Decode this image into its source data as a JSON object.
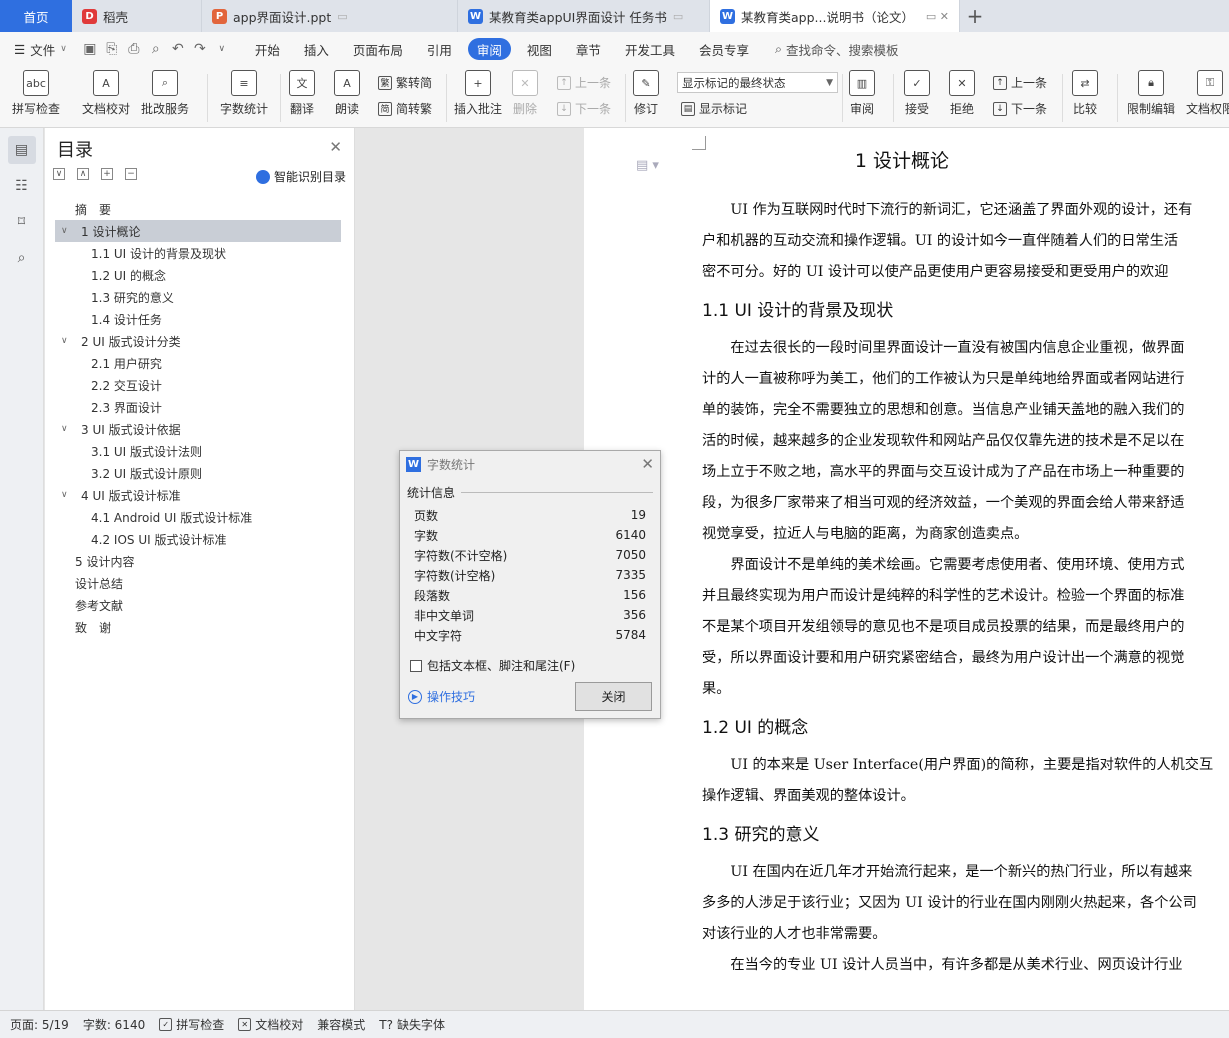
{
  "tabs": [
    {
      "label": "首页"
    },
    {
      "label": "稻壳",
      "icon": "docer-icon",
      "color": "#e03a3a"
    },
    {
      "label": "app界面设计.ppt",
      "icon": "ppt-icon",
      "color": "#e2653c"
    },
    {
      "label": "某教育类appUI界面设计 任务书",
      "icon": "word-icon",
      "color": "#2f6fe0"
    },
    {
      "label": "某教育类app...说明书（论文）",
      "icon": "word-icon",
      "color": "#2f6fe0"
    }
  ],
  "menubar": {
    "file": "文件",
    "items": [
      "开始",
      "插入",
      "页面布局",
      "引用",
      "审阅",
      "视图",
      "章节",
      "开发工具",
      "会员专享"
    ],
    "active": "审阅",
    "search": "查找命令、搜索模板"
  },
  "ribbon": {
    "spell": "拼写检查",
    "proof": "文档校对",
    "batch": "批改服务",
    "wordcount": "字数统计",
    "translate": "翻译",
    "read": "朗读",
    "t2s": "繁转简",
    "s2t": "简转繁",
    "insert_comment": "插入批注",
    "delete": "删除",
    "prev_c": "上一条",
    "next_c": "下一条",
    "revise": "修订",
    "display_mode": "显示标记的最终状态",
    "show_marks": "显示标记",
    "review": "审阅",
    "accept": "接受",
    "reject": "拒绝",
    "prev": "上一条",
    "next": "下一条",
    "compare": "比较",
    "restrict": "限制编辑",
    "doc_perm": "文档权限"
  },
  "toc": {
    "title": "目录",
    "smart": "智能识别目录",
    "items": [
      {
        "label": "摘　要",
        "level": 1,
        "caret": ""
      },
      {
        "label": "1  设计概论",
        "level": 1,
        "caret": "∨",
        "selected": true
      },
      {
        "label": "1.1 UI 设计的背景及现状",
        "level": 2
      },
      {
        "label": "1.2 UI 的概念",
        "level": 2
      },
      {
        "label": "1.3 研究的意义",
        "level": 2
      },
      {
        "label": "1.4 设计任务",
        "level": 2
      },
      {
        "label": "2 UI 版式设计分类",
        "level": 1,
        "caret": "∨"
      },
      {
        "label": "2.1 用户研究",
        "level": 2
      },
      {
        "label": "2.2  交互设计",
        "level": 2
      },
      {
        "label": "2.3  界面设计",
        "level": 2
      },
      {
        "label": "3 UI 版式设计依据",
        "level": 1,
        "caret": "∨"
      },
      {
        "label": "3.1 UI 版式设计法则",
        "level": 2
      },
      {
        "label": "3.2 UI 版式设计原则",
        "level": 2
      },
      {
        "label": "4 UI 版式设计标准",
        "level": 1,
        "caret": "∨"
      },
      {
        "label": "4.1 Android UI 版式设计标准",
        "level": 2
      },
      {
        "label": "4.2 IOS UI 版式设计标准",
        "level": 2
      },
      {
        "label": "5  设计内容",
        "level": 1,
        "caret": ""
      },
      {
        "label": "设计总结",
        "level": 1,
        "caret": ""
      },
      {
        "label": "参考文献",
        "level": 1,
        "caret": ""
      },
      {
        "label": "致　谢",
        "level": 1,
        "caret": ""
      }
    ]
  },
  "dialog": {
    "title": "字数统计",
    "group": "统计信息",
    "rows": [
      {
        "k": "页数",
        "v": "19"
      },
      {
        "k": "字数",
        "v": "6140"
      },
      {
        "k": "字符数(不计空格)",
        "v": "7050"
      },
      {
        "k": "字符数(计空格)",
        "v": "7335"
      },
      {
        "k": "段落数",
        "v": "156"
      },
      {
        "k": "非中文单词",
        "v": "356"
      },
      {
        "k": "中文字符",
        "v": "5784"
      }
    ],
    "checkbox": "包括文本框、脚注和尾注(F)",
    "tips": "操作技巧",
    "close": "关闭"
  },
  "document": {
    "h1": "1  设计概论",
    "p0": [
      "UI 作为互联网时代时下流行的新词汇，它还涵盖了界面外观的设计，还有",
      "户和机器的互动交流和操作逻辑。UI 的设计如今一直伴随着人们的日常生活",
      "密不可分。好的  UI 设计可以使产品更使用户更容易接受和更受用户的欢迎"
    ],
    "h2_1": "1.1 UI 设计的背景及现状",
    "p1": [
      "在过去很长的一段时间里界面设计一直没有被国内信息企业重视，做界面",
      "计的人一直被称呼为美工，他们的工作被认为只是单纯地给界面或者网站进行",
      "单的装饰，完全不需要独立的思想和创意。当信息产业铺天盖地的融入我们的",
      "活的时候，越来越多的企业发现软件和网站产品仅仅靠先进的技术是不足以在",
      "场上立于不败之地，高水平的界面与交互设计成为了产品在市场上一种重要的",
      "段，为很多厂家带来了相当可观的经济效益，一个美观的界面会给人带来舒适",
      "视觉享受，拉近人与电脑的距离，为商家创造卖点。"
    ],
    "p2": [
      "界面设计不是单纯的美术绘画。它需要考虑使用者、使用环境、使用方式",
      "并且最终实现为用户而设计是纯粹的科学性的艺术设计。检验一个界面的标准",
      "不是某个项目开发组领导的意见也不是项目成员投票的结果，而是最终用户的",
      "受，所以界面设计要和用户研究紧密结合，最终为用户设计出一个满意的视觉",
      "果。"
    ],
    "h2_2": "1.2 UI 的概念",
    "p3": [
      "UI 的本来是 User Interface(用户界面)的简称，主要是指对软件的人机交互",
      "操作逻辑、界面美观的整体设计。"
    ],
    "h2_3": "1.3 研究的意义",
    "p4": [
      "UI 在国内在近几年才开始流行起来，是一个新兴的热门行业，所以有越来",
      "多多的人涉足于该行业；又因为  UI 设计的行业在国内刚刚火热起来，各个公司",
      "对该行业的人才也非常需要。"
    ],
    "p5": [
      "在当今的专业  UI 设计人员当中，有许多都是从美术行业、网页设计行业"
    ]
  },
  "status": {
    "page": "页面: 5/19",
    "words": "字数: 6140",
    "spell": "拼写检查",
    "proof": "文档校对",
    "compat": "兼容模式",
    "font": "缺失字体"
  }
}
